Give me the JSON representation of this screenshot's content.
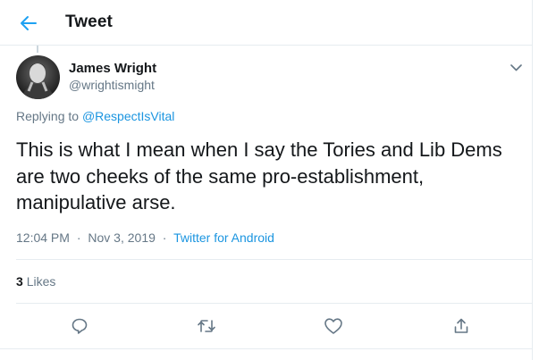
{
  "header": {
    "title": "Tweet",
    "back_icon": "arrow-left-icon",
    "accent_color": "#1da1f2"
  },
  "author": {
    "display_name": "James Wright",
    "handle": "@wrightismight",
    "avatar": "user-avatar-photo"
  },
  "reply_to": {
    "prefix": "Replying to",
    "handle": "@RespectIsVital"
  },
  "tweet": {
    "text": "This is what I mean when I say the Tories and Lib Dems are two cheeks of the same pro-establishment, manipulative arse."
  },
  "meta": {
    "time": "12:04 PM",
    "date": "Nov 3, 2019",
    "separator": "·",
    "source": "Twitter for Android"
  },
  "stats": {
    "likes_count": "3",
    "likes_label": "Likes"
  },
  "actions": [
    {
      "name": "reply",
      "icon": "reply-icon"
    },
    {
      "name": "retweet",
      "icon": "retweet-icon"
    },
    {
      "name": "like",
      "icon": "heart-icon"
    },
    {
      "name": "share",
      "icon": "share-icon"
    }
  ],
  "colors": {
    "link": "#1b95e0",
    "secondary_text": "#657786",
    "primary_text": "#14171a",
    "border": "#e6ecf0"
  }
}
